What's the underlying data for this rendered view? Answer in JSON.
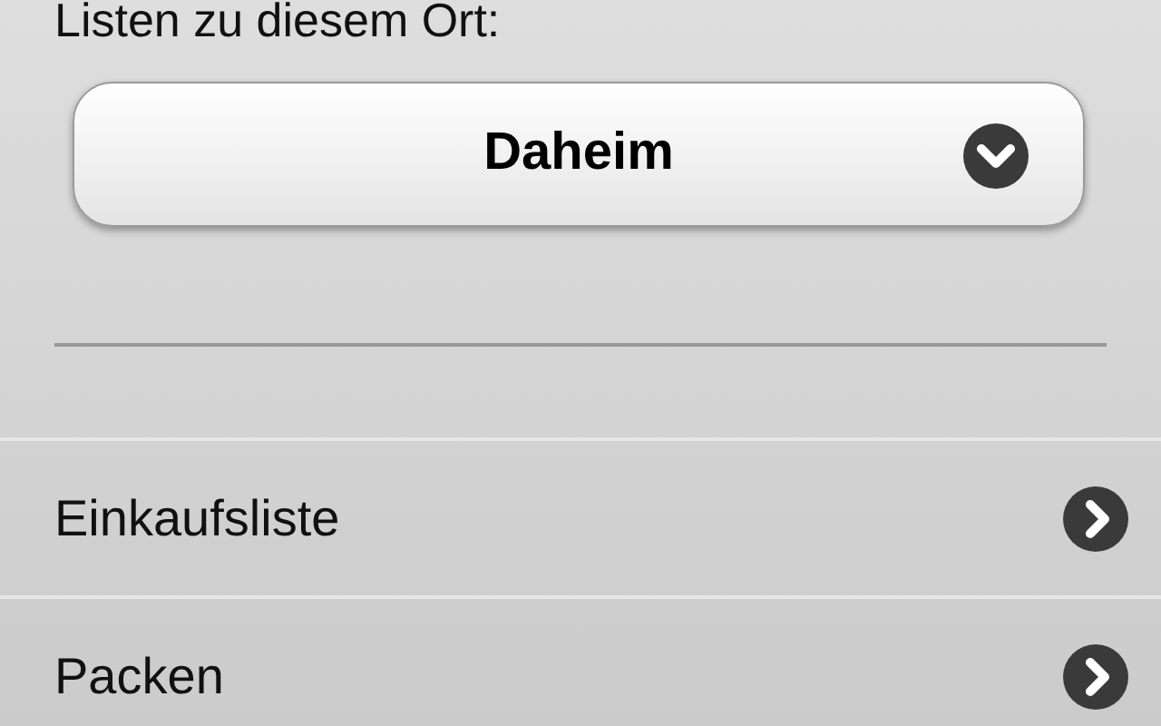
{
  "location_label": "Listen zu diesem Ort:",
  "location_select": {
    "value": "Daheim"
  },
  "lists": [
    {
      "label": "Einkaufsliste"
    },
    {
      "label": "Packen"
    }
  ]
}
